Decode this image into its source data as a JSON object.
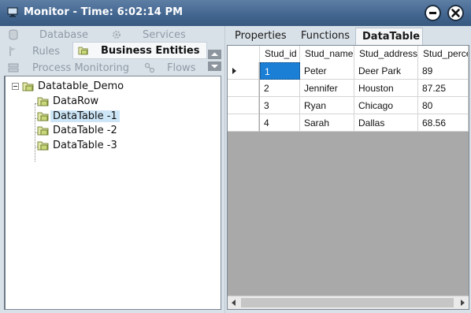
{
  "window": {
    "title": "Monitor - Time: 6:02:14 PM",
    "icons": {
      "app": "monitor-icon",
      "minimize": "minimize-icon",
      "close": "close-icon"
    }
  },
  "nav": {
    "items": [
      {
        "label": "Database",
        "icon": "database-icon"
      },
      {
        "label": "Services",
        "icon": "gear-icon"
      },
      {
        "label": "Rules",
        "icon": "flag-icon"
      },
      {
        "label": "Business Entities",
        "icon": "folder-icon",
        "selected": true
      },
      {
        "label": "Process Monitoring",
        "icon": "process-icon"
      },
      {
        "label": "Flows",
        "icon": "flows-icon"
      }
    ]
  },
  "tree": {
    "root": "Datatable_Demo",
    "children": [
      "DataRow",
      "DataTable -1",
      "DataTable -2",
      "DataTable -3"
    ],
    "selected": "DataTable -1"
  },
  "tabs": [
    "Properties",
    "Functions",
    "DataTable"
  ],
  "active_tab": "DataTable",
  "grid": {
    "columns": [
      "Stud_id",
      "Stud_name",
      "Stud_address",
      "Stud_perce"
    ],
    "rows": [
      [
        "1",
        "Peter",
        "Deer Park",
        "89"
      ],
      [
        "2",
        "Jennifer",
        "Houston",
        "87.25"
      ],
      [
        "3",
        "Ryan",
        "Chicago",
        "80"
      ],
      [
        "4",
        "Sarah",
        "Dallas",
        "68.56"
      ]
    ],
    "current_row_indicator": "row-arrow-icon"
  },
  "colors": {
    "titlebar": "#41658f",
    "selection": "#1c7fd6",
    "tree_selection": "#cde6f7",
    "grid_background": "#a9a9a9"
  }
}
